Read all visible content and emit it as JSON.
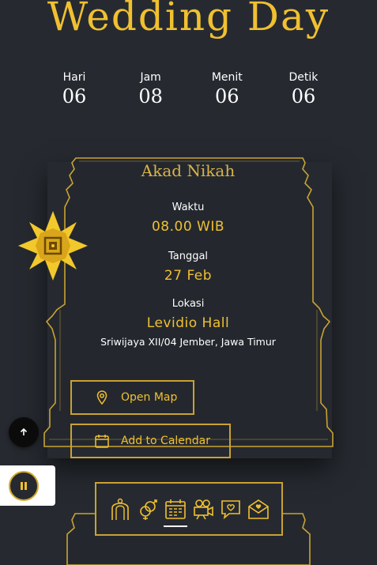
{
  "page": {
    "title": "Wedding Day"
  },
  "countdown": [
    {
      "label": "Hari",
      "value": "06"
    },
    {
      "label": "Jam",
      "value": "08"
    },
    {
      "label": "Menit",
      "value": "06"
    },
    {
      "label": "Detik",
      "value": "06"
    }
  ],
  "event": {
    "title": "Akad Nikah",
    "time_label": "Waktu",
    "time_value": "08.00 WIB",
    "date_label": "Tanggal",
    "date_value": "27 Feb",
    "location_label": "Lokasi",
    "location_name": "Levidio Hall",
    "location_address": "Sriwijaya XII/04 Jember, Jawa Timur"
  },
  "buttons": {
    "open_map": "Open Map",
    "add_calendar": "Add to Calendar"
  },
  "nav": [
    {
      "icon": "wedding-arch-icon",
      "active": false
    },
    {
      "icon": "gender-rings-icon",
      "active": false
    },
    {
      "icon": "calendar-icon",
      "active": true
    },
    {
      "icon": "video-camera-icon",
      "active": false
    },
    {
      "icon": "chat-hearts-icon",
      "active": false
    },
    {
      "icon": "love-letter-icon",
      "active": false
    }
  ],
  "colors": {
    "background": "#262a30",
    "gold": "#f0c030",
    "frame_gold": "#c9a233",
    "text": "#ffffff"
  },
  "icons": {
    "scroll_top": "arrow-up-icon",
    "music": "pause-icon",
    "ornament": "gold-flower-ornament-icon"
  }
}
